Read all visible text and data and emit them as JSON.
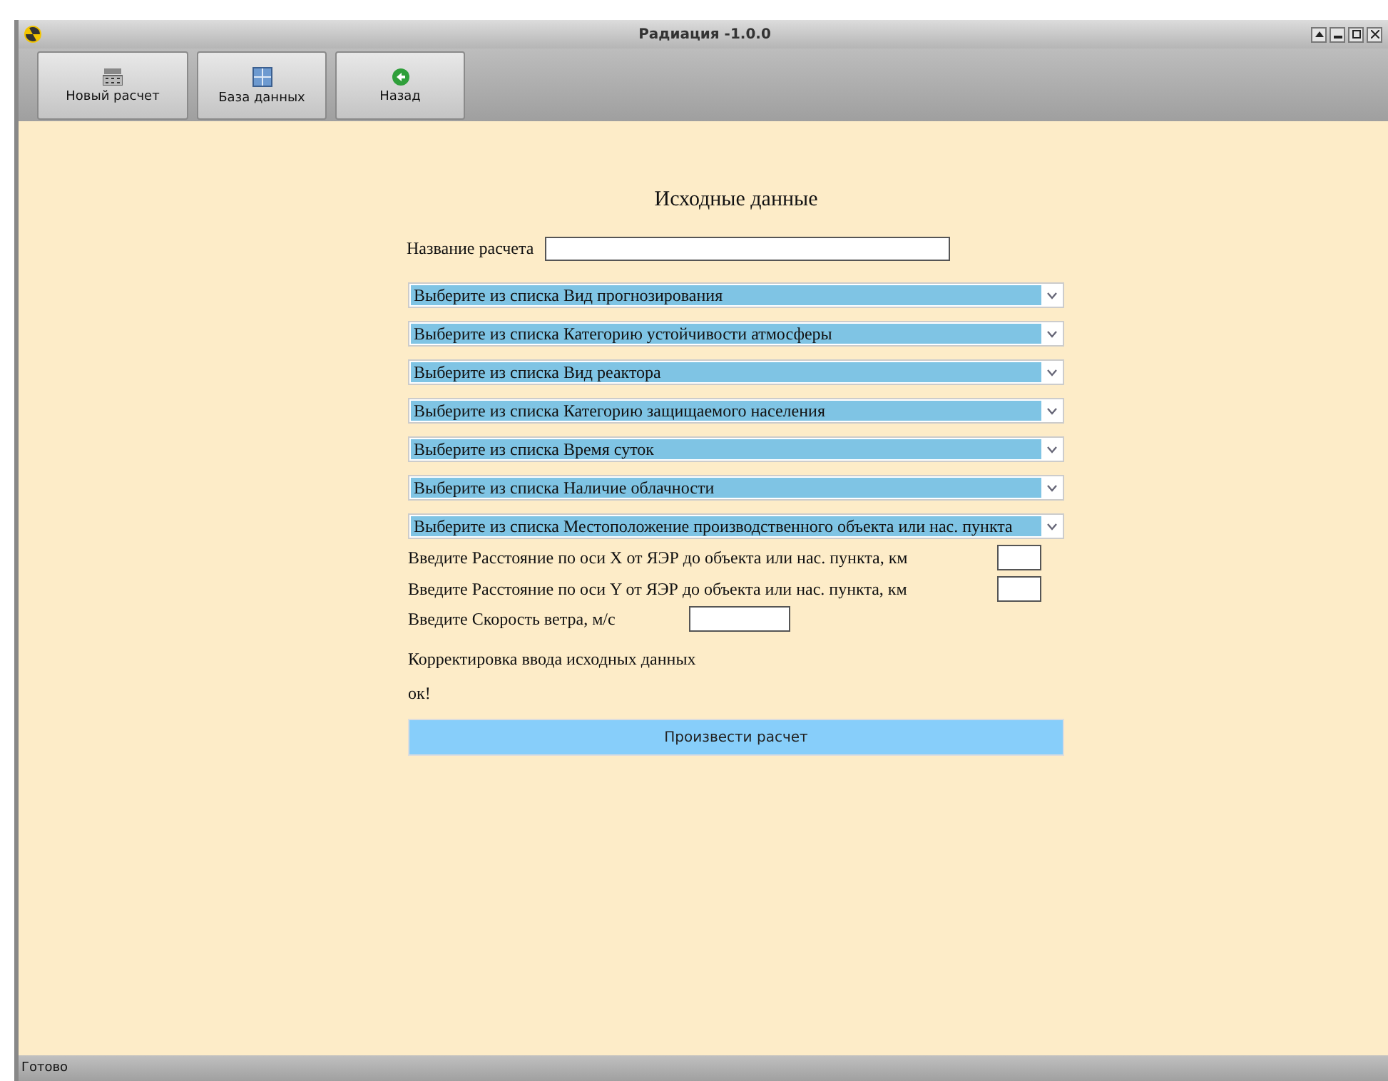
{
  "window": {
    "title": "Радиация -1.0.0"
  },
  "toolbar": [
    {
      "label": "Новый расчет",
      "kind": "calc"
    },
    {
      "label": "База данных",
      "kind": "database"
    },
    {
      "label": "Назад",
      "kind": "back"
    }
  ],
  "form": {
    "heading": "Исходные данные",
    "name_label": "Название расчета",
    "dropdowns": [
      "Выберите из списка Вид прогнозирования",
      "Выберите из списка Категорию устойчивости атмосферы",
      "Выберите из списка Вид реактора",
      "Выберите из списка Категорию  защищаемого населения",
      "Выберите из списка Время суток",
      "Выберите из списка Наличие облачности",
      "Выберите из списка Местоположение производственного объекта или нас. пункта"
    ],
    "x_label": "Введите Расстояние по оси X от ЯЭР до объекта или нас. пункта, км",
    "y_label": "Введите Расстояние по оси Y от ЯЭР до объекта или нас. пункта, км",
    "wind_label": "Введите Скорость ветра, м/с",
    "correction_label": "Корректировка ввода исходных данных",
    "status": "ок!",
    "submit": "Произвести расчет"
  },
  "status_bar": "Готово"
}
